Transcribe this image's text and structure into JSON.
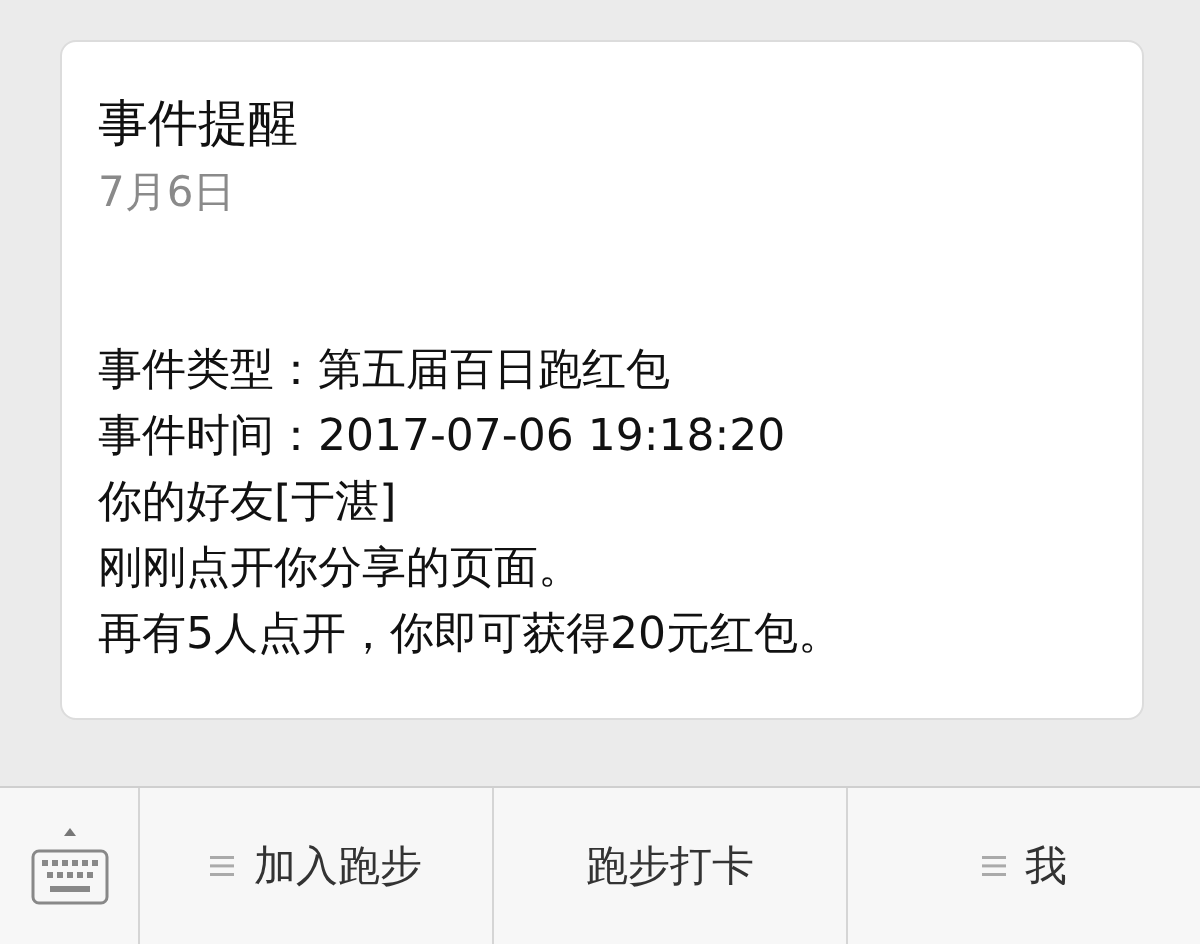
{
  "card": {
    "title": "事件提醒",
    "date": "7月6日",
    "lines": [
      "事件类型：第五届百日跑红包",
      "事件时间：2017-07-06 19:18:20",
      "你的好友[于湛]",
      "刚刚点开你分享的页面。",
      "再有5人点开，你即可获得20元红包。"
    ]
  },
  "menu": [
    {
      "label": "加入跑步",
      "has_submenu": true
    },
    {
      "label": "跑步打卡",
      "has_submenu": false
    },
    {
      "label": "我",
      "has_submenu": true
    }
  ]
}
